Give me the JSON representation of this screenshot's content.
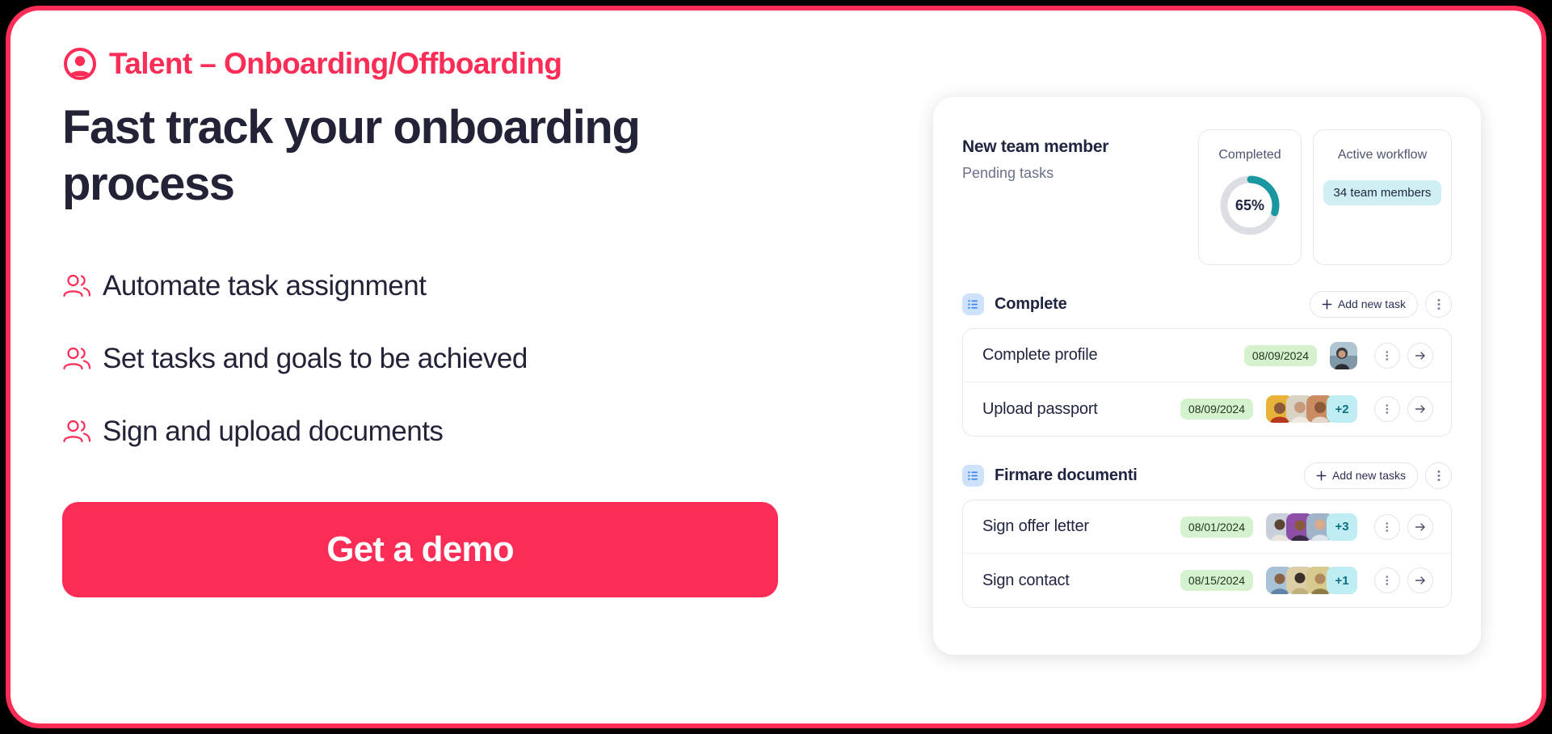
{
  "theme": {
    "accent": "#FB2C55",
    "ink": "#1F2440",
    "muted": "#6B7089",
    "donut_track": "#DCDEE3",
    "donut_arc": "#1B97A2",
    "date_pill_bg": "#D5F2CE",
    "members_badge_bg": "#CFEFF4",
    "avatar_more_bg": "#BEEDF3",
    "list_icon_bg": "#CFE2FB",
    "card_border": "#E6E8EF"
  },
  "eyebrow": {
    "icon": "talent-user-circle-icon",
    "label": "Talent – Onboarding/Offboarding"
  },
  "headline": "Fast track your onboarding process",
  "features": [
    {
      "icon": "people-icon",
      "label": "Automate task assignment"
    },
    {
      "icon": "people-icon",
      "label": "Set tasks and goals to be achieved"
    },
    {
      "icon": "people-icon",
      "label": "Sign and upload documents"
    }
  ],
  "cta": {
    "label": "Get a demo"
  },
  "dashboard": {
    "title": "New team member",
    "subtitle": "Pending tasks",
    "stats": {
      "completed": {
        "label": "Completed",
        "value_text": "65%",
        "value": 65
      },
      "active_workflow": {
        "label": "Active workflow",
        "badge": "34 team members"
      }
    },
    "groups": [
      {
        "icon": "list-icon",
        "title": "Complete",
        "add_label": "Add new task",
        "add_icon": "plus-icon",
        "menu_icon": "kebab-menu-icon",
        "tasks": [
          {
            "name": "Complete profile",
            "date": "08/09/2024",
            "avatars": [
              "#8FB3C4"
            ],
            "extra": null,
            "menu_icon": "kebab-menu-icon",
            "open_icon": "arrow-right-icon"
          },
          {
            "name": "Upload passport",
            "date": "08/09/2024",
            "avatars": [
              "#E8B23A",
              "#D9D3C6",
              "#C98C63"
            ],
            "extra": "+2",
            "menu_icon": "kebab-menu-icon",
            "open_icon": "arrow-right-icon"
          }
        ]
      },
      {
        "icon": "list-icon",
        "title": "Firmare documenti",
        "add_label": "Add new tasks",
        "add_icon": "plus-icon",
        "menu_icon": "kebab-menu-icon",
        "tasks": [
          {
            "name": "Sign offer letter",
            "date": "08/01/2024",
            "avatars": [
              "#B7BFD0",
              "#8E4FA8",
              "#9FB4C9"
            ],
            "extra": "+3",
            "menu_icon": "kebab-menu-icon",
            "open_icon": "arrow-right-icon"
          },
          {
            "name": "Sign contact",
            "date": "08/15/2024",
            "avatars": [
              "#7E9DC0",
              "#D6C9A8",
              "#C2B07C"
            ],
            "extra": "+1",
            "menu_icon": "kebab-menu-icon",
            "open_icon": "arrow-right-icon"
          }
        ]
      }
    ]
  }
}
